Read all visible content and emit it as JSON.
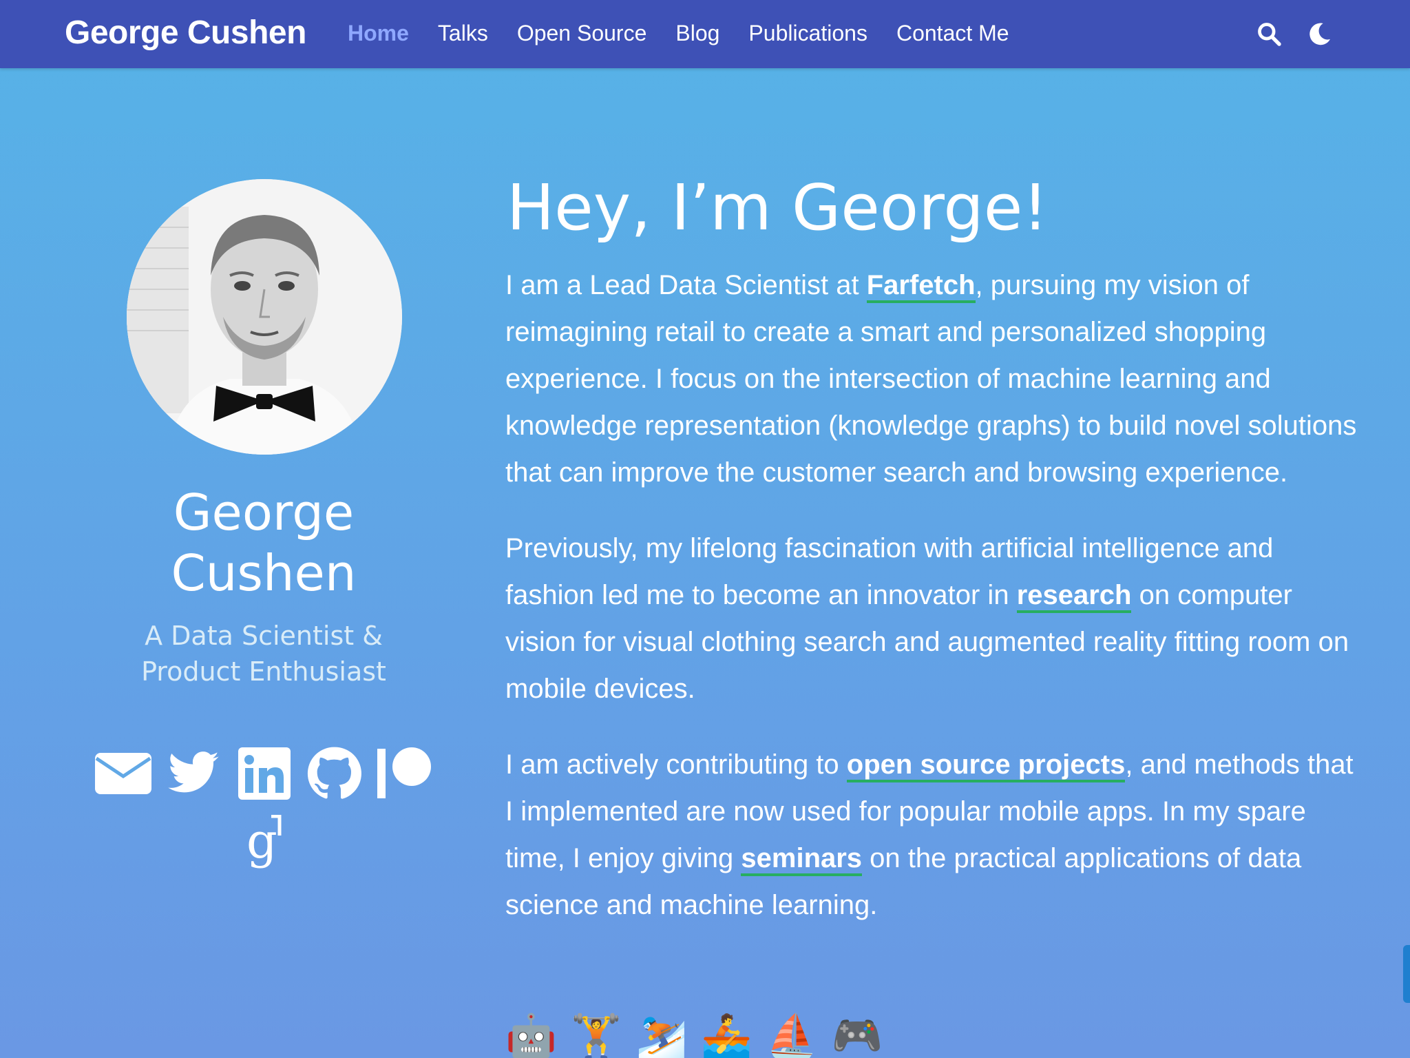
{
  "navbar": {
    "brand": "George Cushen",
    "links": [
      "Home",
      "Talks",
      "Open Source",
      "Blog",
      "Publications",
      "Contact Me"
    ],
    "active_index": 0,
    "icons": {
      "search": "search-icon",
      "theme": "moon-icon"
    }
  },
  "profile": {
    "name_first": "George",
    "name_last": "Cushen",
    "role_line1": "A Data Scientist &",
    "role_line2": "Product Enthusiast",
    "socials": [
      "envelope-icon",
      "twitter-icon",
      "linkedin-icon",
      "github-icon",
      "patreon-icon",
      "google-scholar-icon"
    ]
  },
  "main": {
    "heading": "Hey, I’m George!",
    "p1": {
      "before": "I am a Lead Data Scientist at ",
      "link": "Farfetch",
      "after": ", pursuing my vision of reimagining retail to create a smart and personalized shopping experience. I focus on the intersection of machine learning and knowledge representation (knowledge graphs) to build novel solutions that can improve the customer search and browsing experience."
    },
    "p2": {
      "before": "Previously, my lifelong fascination with artificial intelligence and fashion led me to become an innovator in ",
      "link": "research",
      "after": " on computer vision for visual clothing search and augmented reality fitting room on mobile devices."
    },
    "p3": {
      "before": "I am actively contributing to ",
      "link1": "open source projects",
      "middle": ", and methods that I implemented are now used for popular mobile apps. In my spare time, I enjoy giving ",
      "link2": "seminars",
      "after": " on the practical applications of data science and machine learning."
    },
    "emojis": [
      "🤖",
      "🏋️",
      "⛷️",
      "🚣",
      "⛵",
      "🎮"
    ]
  },
  "colors": {
    "navbar_bg": "#3e51b6",
    "nav_active": "#8fa8ff",
    "link_underline": "#27ae60",
    "page_bg_top": "#56b3e7",
    "page_bg_bottom": "#6a98e4"
  }
}
